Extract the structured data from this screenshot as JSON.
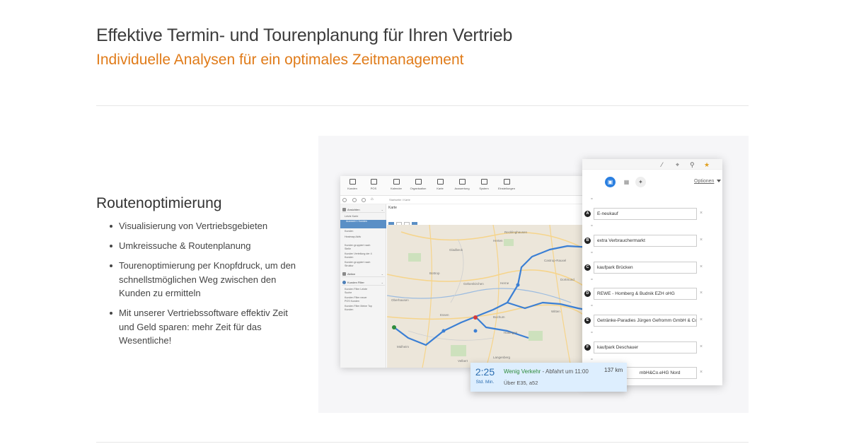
{
  "header": {
    "title": "Effektive Termin- und Tourenplanung für Ihren Vertrieb",
    "subtitle": "Individuelle Analysen für ein optimales Zeitmanagement"
  },
  "section": {
    "heading": "Routenoptimierung",
    "features": [
      "Visualisierung von Vertriebsgebieten",
      "Umkreissuche & Routenplanung",
      "Tourenoptimierung per Knopfdruck, um den schnellstmöglichen Weg zwischen den Kunden zu ermitteln",
      "Mit unserer Vertriebssoftware effektiv Zeit und Geld sparen: mehr Zeit für das Wesentliche!"
    ]
  },
  "app": {
    "toolbar": [
      "Kunden",
      "POS",
      "Kalender",
      "Organisation",
      "Karte",
      "Auswertung",
      "System",
      "Einstellungen"
    ],
    "breadcrumb": "Startseite  /  Karte",
    "map_title": "Karte",
    "sidebar": {
      "head_ansichten": "Ansichten",
      "items_ansichten": [
        "Letzte Karte",
        "Auswahl 1 Kunden",
        "Kunden",
        "Heatmap Aktiv",
        "Kunden gruppiert nach Stelle",
        "Kunden Verteilung der 4 Kunden",
        "Kunden gruppiert nach Struktur"
      ],
      "head_aktion": "Aktion",
      "head_filter": "Kunden Filter",
      "items_filter": [
        "Kunden Filter Letzte Suche",
        "Kunden Filter neuer POS Kunden",
        "Kunden Filter Meine Top Kunden"
      ]
    },
    "map_places": [
      "Recklinghausen",
      "Herten",
      "Castrop-Rauxel",
      "Gladbeck",
      "Bottrop",
      "Gelsenkirchen",
      "Herne",
      "Oberhausen",
      "Essen",
      "Bochum",
      "Witten",
      "Mülheim",
      "Hattingen",
      "Velbert",
      "Langenberg",
      "Dortmund"
    ]
  },
  "route_panel": {
    "options_label": "Optionen",
    "mode_icons": [
      "car-icon",
      "bus-icon",
      "walk-icon"
    ],
    "stops": [
      {
        "letter": "A",
        "name": "E-neukauf"
      },
      {
        "letter": "B",
        "name": "extra Verbrauchermarkt"
      },
      {
        "letter": "C",
        "name": "kaufpark Brücken"
      },
      {
        "letter": "D",
        "name": "REWE - Homberg & Budnik EZH oHG"
      },
      {
        "letter": "E",
        "name": "Getränke-Paradies Jürgen Gefromm GmbH & Co"
      },
      {
        "letter": "F",
        "name": "kaufpark Deschauer"
      },
      {
        "letter": "G",
        "name": "mbH&Co.eHG Nord"
      }
    ]
  },
  "eta": {
    "time": "2:25",
    "units": "Std.  Min.",
    "traffic": "Wenig Verkehr",
    "departure": " - Abfahrt um 11:00",
    "distance": "137 km",
    "via": "Über E35, a52"
  },
  "colors": {
    "accent_orange": "#e07b19",
    "route_blue": "#3b7fd4",
    "selected_blue": "#5a8fc6"
  }
}
